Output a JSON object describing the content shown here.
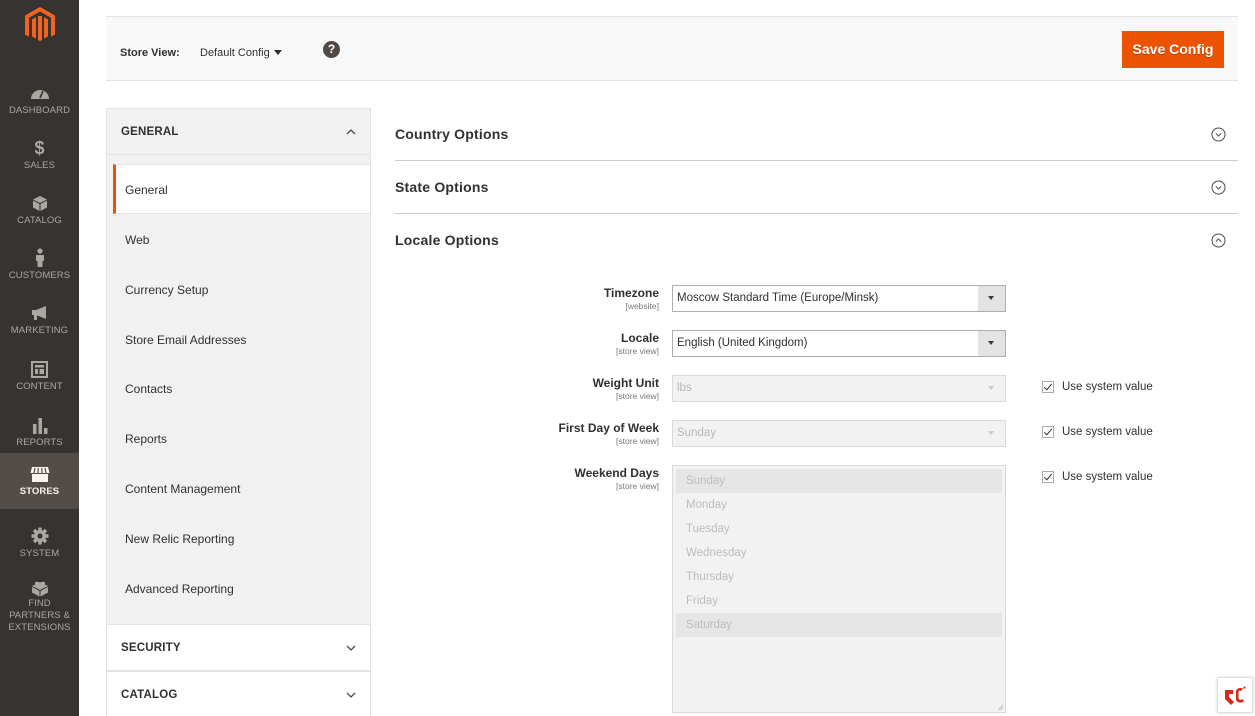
{
  "admin_nav": {
    "items": [
      {
        "label": "DASHBOARD",
        "icon": "dashboard-icon",
        "active": false
      },
      {
        "label": "SALES",
        "icon": "dollar-icon",
        "active": false
      },
      {
        "label": "CATALOG",
        "icon": "box-icon",
        "active": false
      },
      {
        "label": "CUSTOMERS",
        "icon": "person-icon",
        "active": false
      },
      {
        "label": "MARKETING",
        "icon": "megaphone-icon",
        "active": false
      },
      {
        "label": "CONTENT",
        "icon": "layout-icon",
        "active": false
      },
      {
        "label": "REPORTS",
        "icon": "bar-chart-icon",
        "active": false
      },
      {
        "label": "STORES",
        "icon": "storefront-icon",
        "active": true
      },
      {
        "label": "SYSTEM",
        "icon": "gear-icon",
        "active": false
      },
      {
        "label": "FIND PARTNERS & EXTENSIONS",
        "icon": "lego-brick-icon",
        "active": false
      }
    ]
  },
  "header": {
    "store_view_label": "Store View:",
    "store_view_value": "Default Config",
    "help_symbol": "?",
    "save_label": "Save Config"
  },
  "colors": {
    "accent": "#eb5202",
    "nav_bg": "#373330",
    "nav_active_bg": "#524d49"
  },
  "config_tabs": {
    "groups": [
      {
        "title": "GENERAL",
        "expanded": true
      },
      {
        "title": "SECURITY",
        "expanded": false
      },
      {
        "title": "CATALOG",
        "expanded": false
      }
    ],
    "general_items": [
      {
        "label": "General",
        "active": true
      },
      {
        "label": "Web",
        "active": false
      },
      {
        "label": "Currency Setup",
        "active": false
      },
      {
        "label": "Store Email Addresses",
        "active": false
      },
      {
        "label": "Contacts",
        "active": false
      },
      {
        "label": "Reports",
        "active": false
      },
      {
        "label": "Content Management",
        "active": false
      },
      {
        "label": "New Relic Reporting",
        "active": false
      },
      {
        "label": "Advanced Reporting",
        "active": false
      }
    ]
  },
  "sections": [
    {
      "title": "Country Options",
      "expanded": false
    },
    {
      "title": "State Options",
      "expanded": false
    },
    {
      "title": "Locale Options",
      "expanded": true
    }
  ],
  "locale_fields": {
    "timezone": {
      "label": "Timezone",
      "scope": "[website]",
      "value": "Moscow Standard Time (Europe/Minsk)",
      "disabled": false
    },
    "locale": {
      "label": "Locale",
      "scope": "[store view]",
      "value": "English (United Kingdom)",
      "disabled": false
    },
    "weight_unit": {
      "label": "Weight Unit",
      "scope": "[store view]",
      "value": "lbs",
      "disabled": true,
      "use_system_value": true
    },
    "first_day": {
      "label": "First Day of Week",
      "scope": "[store view]",
      "value": "Sunday",
      "disabled": true,
      "use_system_value": true
    },
    "weekend_days": {
      "label": "Weekend Days",
      "scope": "[store view]",
      "disabled": true,
      "use_system_value": true,
      "options": [
        {
          "label": "Sunday",
          "selected": true
        },
        {
          "label": "Monday",
          "selected": false
        },
        {
          "label": "Tuesday",
          "selected": false
        },
        {
          "label": "Wednesday",
          "selected": false
        },
        {
          "label": "Thursday",
          "selected": false
        },
        {
          "label": "Friday",
          "selected": false
        },
        {
          "label": "Saturday",
          "selected": true
        }
      ]
    },
    "use_system_value_label": "Use system value"
  }
}
